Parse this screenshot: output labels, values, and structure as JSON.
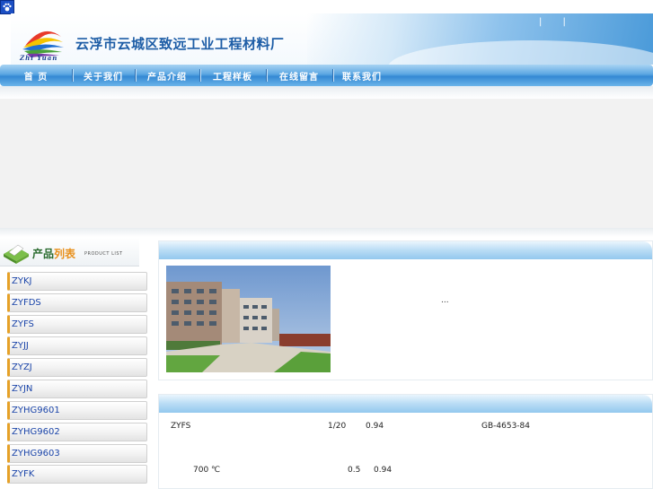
{
  "header": {
    "logo_text": "Zhi Yuan",
    "title": "云浮市云城区致远工业工程材料厂",
    "links": "| |"
  },
  "nav": {
    "items": [
      {
        "label": "首 页"
      },
      {
        "label": "关于我们"
      },
      {
        "label": "产品介绍"
      },
      {
        "label": "工程样板"
      },
      {
        "label": "在线留言"
      },
      {
        "label": "联系我们"
      }
    ]
  },
  "sidebar": {
    "title_a": "产品",
    "title_b": "列表",
    "subtitle": "PRODUCT LIST",
    "items": [
      {
        "label": "ZYKJ"
      },
      {
        "label": "ZYFDS"
      },
      {
        "label": "ZYFS"
      },
      {
        "label": "ZYJJ"
      },
      {
        "label": "ZYZJ"
      },
      {
        "label": "ZYJN"
      },
      {
        "label": "ZYHG9601"
      },
      {
        "label": "ZYHG9602"
      },
      {
        "label": "ZYHG9603"
      },
      {
        "label": "ZYFK"
      }
    ]
  },
  "about": {
    "ellipsis": "..."
  },
  "specs": {
    "row1": {
      "product": "ZYFS",
      "ratio": "1/20",
      "value": "0.94",
      "standard": "GB-4653-84"
    },
    "row2": {
      "temp": "700 ℃",
      "a": "0.5",
      "b": "0.94"
    }
  },
  "colors": {
    "nav": "#3489d3",
    "title": "#1d5da6",
    "sidebar_text": "#1a44a8",
    "sidebar_accent": "#e6a127"
  }
}
